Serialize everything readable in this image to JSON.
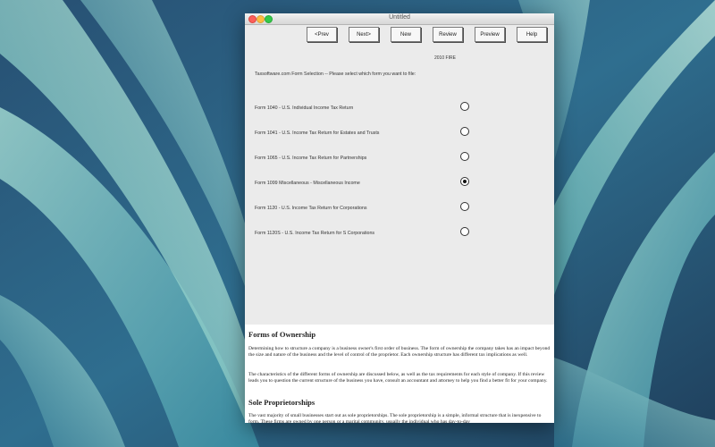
{
  "window": {
    "title": "Untitled"
  },
  "toolbar": {
    "prev": "<Prev",
    "next": "Next>",
    "new": "New",
    "review": "Review",
    "preview": "Preview",
    "help": "Help",
    "year": "2010 FIRE"
  },
  "form_selection": {
    "prompt": "Taxsoftware.com Form Selection -- Please select which form you want to file:",
    "selected_index": 3,
    "options": [
      "Form 1040 - U.S. Individual Income Tax Return",
      "Form 1041 - U.S. Income Tax Return for Estates and Trusts",
      "Form 1065 - U.S. Income Tax Return for Partnerships",
      "Form 1099 Miscellaneous - Miscellaneous Income",
      "Form 1120 - U.S. Income Tax Return for Corporations",
      "Form 1120S - U.S. Income Tax Return for S Corporations"
    ]
  },
  "info": {
    "heading1": "Forms of Ownership",
    "para1": "Determining how to structure a company is a business owner's first order of business. The form of ownership the company takes has an impact beyond the size and nature of the business and the level of control of the proprietor. Each ownership structure has different tax implications as well.",
    "para2": "The characteristics of the different forms of ownership are discussed below, as well as the tax requirements for each style of company. If this review leads you to question the current structure of the business you have, consult an accountant and attorney to help you find a better fit for your company.",
    "heading2": "Sole Proprietorships",
    "para3": "The vast majority of small businesses start out as sole proprietorships. The sole proprietorship is a simple, informal structure that is inexpensive to form. These firms are owned by one person or a marital community, usually the individual who has day-to-day"
  },
  "colors": {
    "window_bg": "#ebebeb",
    "desktop": "#2c5f86"
  }
}
